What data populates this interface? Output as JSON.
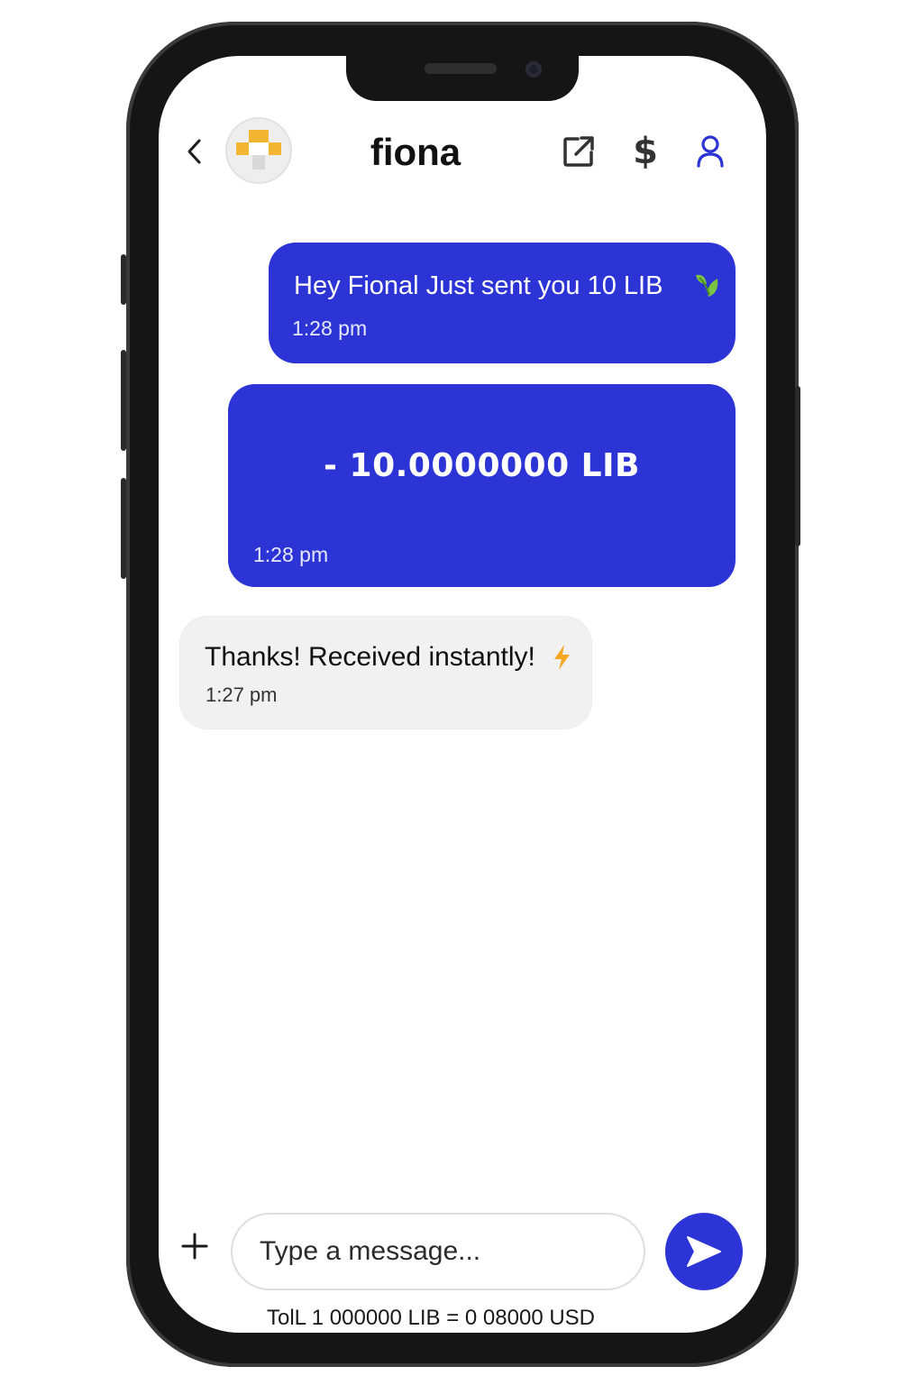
{
  "header": {
    "contact_name": "fiona",
    "back_icon": "chevron-left-icon",
    "edit_icon": "external-edit-icon",
    "dollar_label": "$",
    "profile_icon": "user-icon"
  },
  "messages": [
    {
      "direction": "outgoing",
      "text": "Hey Fional Just sent you 10 LIB",
      "emoji_icon": "leaf-icon",
      "time": "1:28 pm"
    },
    {
      "direction": "outgoing",
      "type": "payment",
      "amount": "- 10.0000000 LIB",
      "time": "1:28 pm"
    },
    {
      "direction": "incoming",
      "text": "Thanks! Received instantly!",
      "emoji_icon": "lightning-icon",
      "time": "1:27 pm"
    }
  ],
  "composer": {
    "placeholder": "Type a message...",
    "value": "",
    "add_icon": "plus-icon",
    "send_icon": "send-icon"
  },
  "toll_text": "TolL 1 000000 LIB = 0 08000 USD",
  "colors": {
    "accent": "#2c34d5",
    "incoming_bubble": "#f1f1f1",
    "leaf": "#7cc243",
    "bolt": "#f5a623",
    "avatar_tile": "#f2b632"
  }
}
